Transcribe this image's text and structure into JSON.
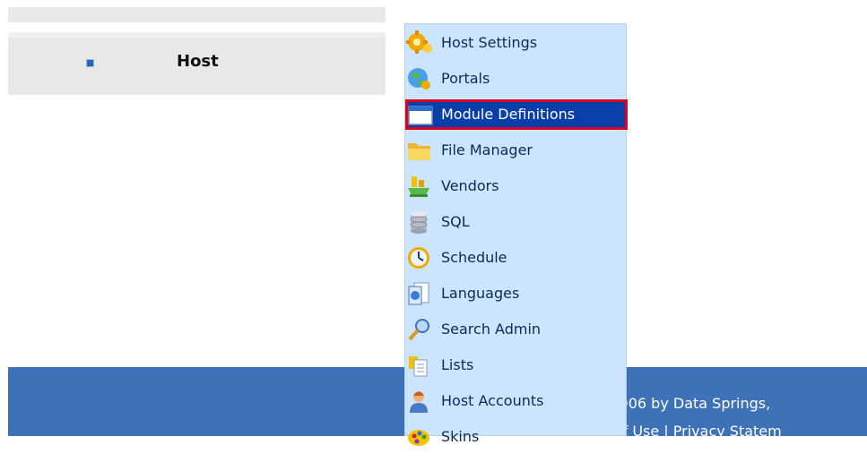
{
  "nav": {
    "host_label": "Host"
  },
  "menu": {
    "items": [
      {
        "label": "Host Settings",
        "icon": "gear-settings-icon"
      },
      {
        "label": "Portals",
        "icon": "globe-icon"
      },
      {
        "label": "Module Definitions",
        "icon": "window-icon",
        "selected": true
      },
      {
        "label": "File Manager",
        "icon": "folder-icon"
      },
      {
        "label": "Vendors",
        "icon": "vendor-icon"
      },
      {
        "label": "SQL",
        "icon": "database-icon"
      },
      {
        "label": "Schedule",
        "icon": "clock-icon"
      },
      {
        "label": "Languages",
        "icon": "languages-icon"
      },
      {
        "label": "Search Admin",
        "icon": "magnifier-icon"
      },
      {
        "label": "Lists",
        "icon": "lists-icon"
      },
      {
        "label": "Host Accounts",
        "icon": "user-icon"
      },
      {
        "label": "Skins",
        "icon": "palette-icon"
      }
    ]
  },
  "footer": {
    "copyright": "t 2006 by Data Springs,",
    "terms": "Of Use",
    "separator": "|",
    "privacy": "Privacy Statem"
  },
  "colors": {
    "menu_bg": "#cce5ff",
    "menu_highlight": "#0a3ea8",
    "highlight_border": "#e0001a",
    "footer_bg": "#3d72b8"
  }
}
